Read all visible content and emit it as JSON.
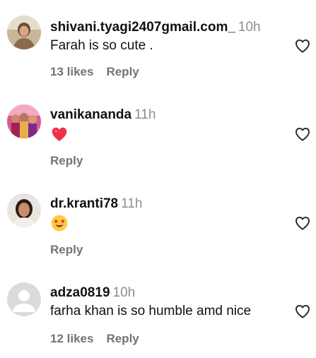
{
  "comments": [
    {
      "username": "shivani.tyagi2407gmail.com_",
      "time": "10h",
      "text": "Farah is so cute .",
      "likes": "13 likes",
      "reply": "Reply"
    },
    {
      "username": "vanikananda",
      "time": "11h",
      "emoji": "red-heart-emoji",
      "reply": "Reply"
    },
    {
      "username": "dr.kranti78",
      "time": "11h",
      "emoji": "heart-eyes-emoji",
      "reply": "Reply"
    },
    {
      "username": "adza0819",
      "time": "10h",
      "text": "farha khan is so humble amd nice",
      "likes": "12 likes",
      "reply": "Reply"
    }
  ],
  "icons": {
    "like": "heart-outline-icon"
  },
  "colors": {
    "text": "#111111",
    "muted": "#737373",
    "time": "#8e8e8e",
    "heart_emoji": "#f0304a",
    "heart_outline": "#262626"
  }
}
